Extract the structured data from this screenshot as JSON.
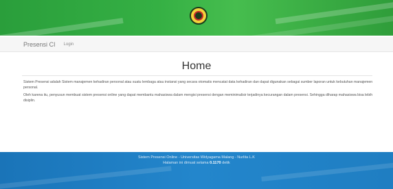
{
  "navbar": {
    "brand": "Presensi CI",
    "login": "Login"
  },
  "main": {
    "title": "Home",
    "paragraph1": "Sistem Presensi adalah Sistem manajemen kehadiran personal atau suatu lembaga atau instansi yang secara otomatis mencatat data kehadiran dan dapat digunakan sebagai sumber laporan untuk kebutuhan manajemen personal.",
    "paragraph2": "Oleh karena itu, penyusun membuat sistem presensi online yang dapat membantu mahasiswa dalam mengisi presensi dengan meminimalisir terjadinya kecurangan dalam presensi. Sehingga diharap mahasiswa bisa lebih disiplin."
  },
  "footer": {
    "line1": "Sistem Presensi Online - Universitas Widyagama Malang - Nurlita L.K",
    "line2_prefix": "Halaman ini dimuat selama ",
    "load_time": "0.1170",
    "line2_suffix": " detik"
  },
  "colors": {
    "header_green": "#35b044",
    "footer_blue": "#2386cc"
  },
  "icons": {
    "logo": "university-seal-icon"
  }
}
